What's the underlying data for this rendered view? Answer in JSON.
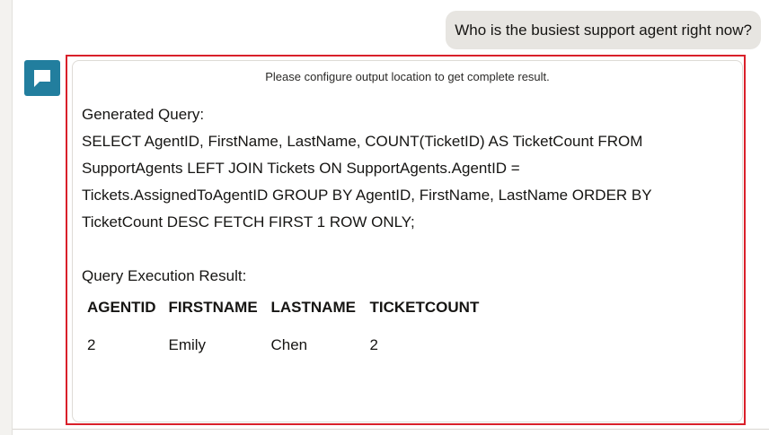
{
  "user_message": "Who is the busiest support agent right now?",
  "bot": {
    "avatar_icon": "chat-bubble-icon",
    "avatar_color": "#227e9e"
  },
  "answer": {
    "notice": "Please configure output location to get complete result.",
    "generated_query_label": "Generated Query:",
    "query": "SELECT AgentID, FirstName, LastName, COUNT(TicketID) AS TicketCount FROM SupportAgents LEFT JOIN Tickets ON SupportAgents.AgentID = Tickets.AssignedToAgentID GROUP BY AgentID, FirstName, LastName ORDER BY TicketCount DESC FETCH FIRST 1 ROW ONLY;",
    "execution_result_label": "Query Execution Result:",
    "table": {
      "headers": [
        "AGENTID",
        "FIRSTNAME",
        "LASTNAME",
        "TICKETCOUNT"
      ],
      "rows": [
        [
          "2",
          "Emily",
          "Chen",
          "2"
        ]
      ]
    }
  },
  "highlight_color": "#d9202a"
}
